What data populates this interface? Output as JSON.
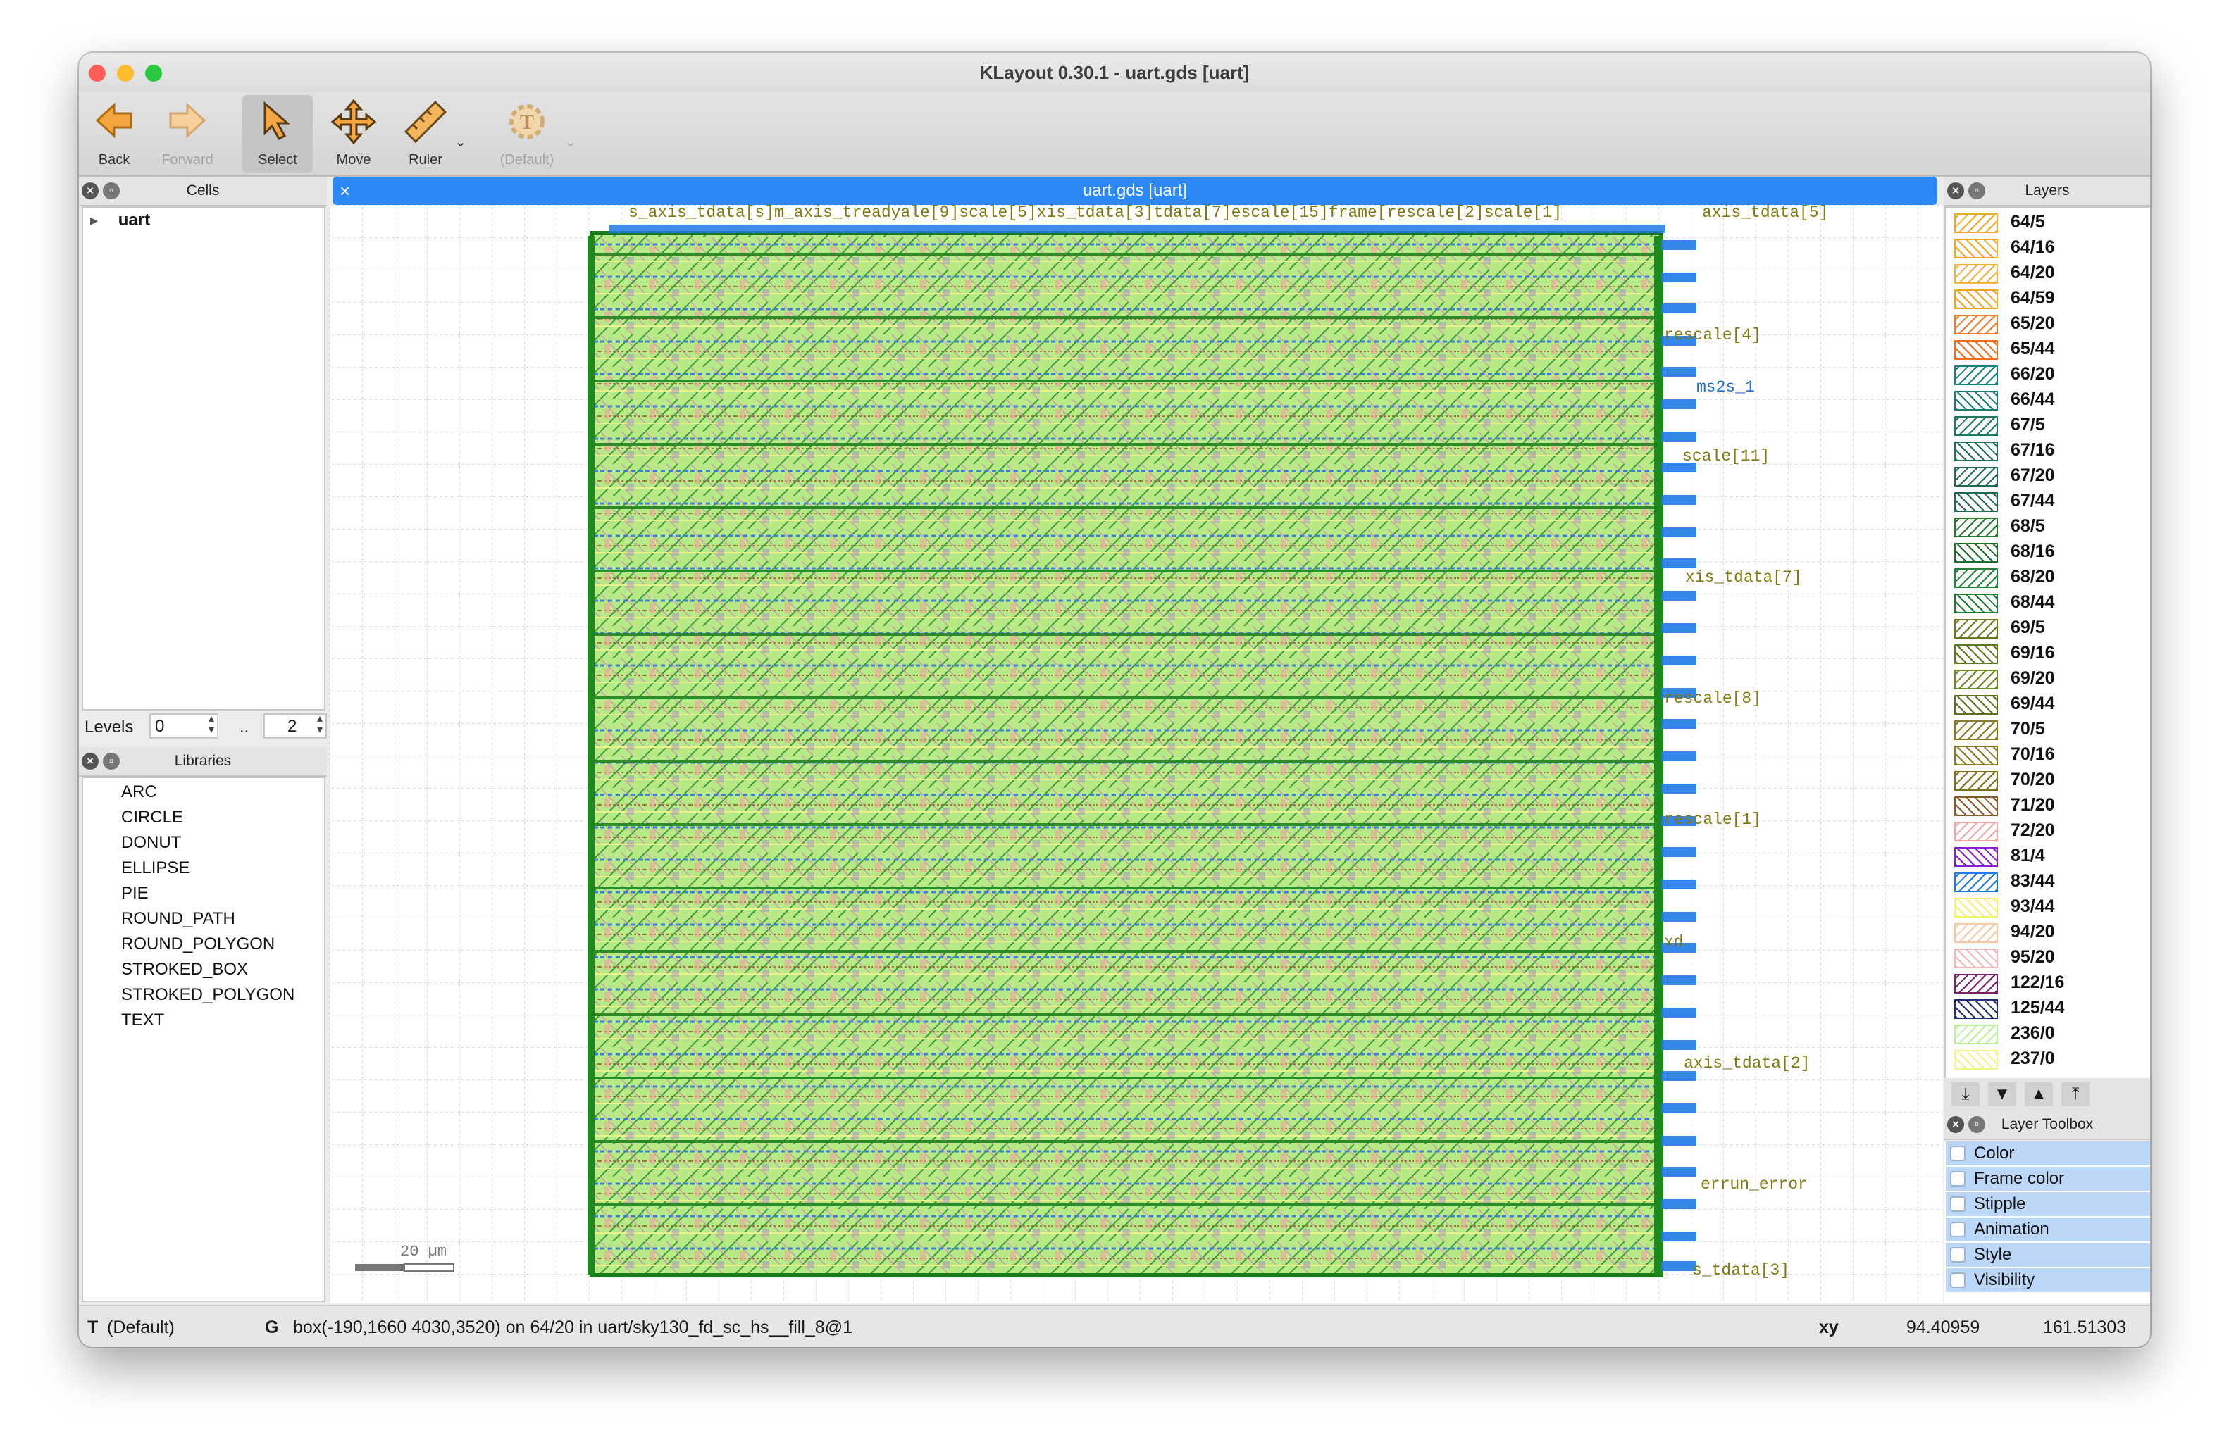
{
  "window": {
    "title": "KLayout 0.30.1 - uart.gds [uart]"
  },
  "toolbar": {
    "buttons": [
      {
        "label": "Back",
        "icon": "back-arrow-icon"
      },
      {
        "label": "Forward",
        "icon": "forward-arrow-icon"
      },
      {
        "label": "Select",
        "icon": "select-cursor-icon"
      },
      {
        "label": "Move",
        "icon": "move-cross-icon"
      },
      {
        "label": "Ruler",
        "icon": "ruler-icon"
      },
      {
        "label": "(Default)",
        "icon": "text-gear-icon"
      }
    ]
  },
  "cells_panel": {
    "title": "Cells",
    "tree": [
      {
        "label": "uart",
        "expander": "▸"
      }
    ],
    "levels": {
      "label": "Levels",
      "from": "0",
      "sep": "..",
      "to": "2"
    }
  },
  "libraries_panel": {
    "title": "Libraries",
    "items": [
      "ARC",
      "CIRCLE",
      "DONUT",
      "ELLIPSE",
      "PIE",
      "ROUND_PATH",
      "ROUND_POLYGON",
      "STROKED_BOX",
      "STROKED_POLYGON",
      "TEXT"
    ]
  },
  "canvas": {
    "tab_title": "uart.gds [uart]",
    "scale_label": "20 µm",
    "top_labels": "s_axis_tdata[s]m_axis_treadyale[9]scale[5]xis_tdata[3]tdata[7]escale[15]frame[rescale[2]scale[1]",
    "top_right_label": "axis_tdata[5]",
    "right_labels": [
      "rescale[4]",
      "ms2s_1",
      "scale[11]",
      "xis_tdata[7]",
      "rescale[8]",
      "rescale[1]",
      "xd",
      "axis_tdata[2]",
      "errun_error",
      "s_tdata[3]"
    ]
  },
  "layers_panel": {
    "title": "Layers",
    "layers": [
      {
        "name": "64/5",
        "color": "#f5a623"
      },
      {
        "name": "64/16",
        "color": "#f5a623"
      },
      {
        "name": "64/20",
        "color": "#f5b13d"
      },
      {
        "name": "64/59",
        "color": "#f2a21e"
      },
      {
        "name": "65/20",
        "color": "#f07b2a"
      },
      {
        "name": "65/44",
        "color": "#f36b1f"
      },
      {
        "name": "66/20",
        "color": "#16837f"
      },
      {
        "name": "66/44",
        "color": "#1a7a78"
      },
      {
        "name": "67/5",
        "color": "#1b7c5c"
      },
      {
        "name": "67/16",
        "color": "#1f6f57"
      },
      {
        "name": "67/20",
        "color": "#236a52"
      },
      {
        "name": "67/44",
        "color": "#1f6a4a"
      },
      {
        "name": "68/5",
        "color": "#237a2f"
      },
      {
        "name": "68/16",
        "color": "#1d6d2a"
      },
      {
        "name": "68/20",
        "color": "#1b8a36"
      },
      {
        "name": "68/44",
        "color": "#1d7a33"
      },
      {
        "name": "69/5",
        "color": "#6a7a1f"
      },
      {
        "name": "69/16",
        "color": "#5d7a1a"
      },
      {
        "name": "69/20",
        "color": "#6b8a25"
      },
      {
        "name": "69/44",
        "color": "#5d7020"
      },
      {
        "name": "70/5",
        "color": "#8b7a1e"
      },
      {
        "name": "70/16",
        "color": "#8a7a22"
      },
      {
        "name": "70/20",
        "color": "#7f6f1a"
      },
      {
        "name": "71/20",
        "color": "#8a5a2a"
      },
      {
        "name": "72/20",
        "color": "#f0a5a5"
      },
      {
        "name": "81/4",
        "color": "#8a1fd0"
      },
      {
        "name": "83/44",
        "color": "#1f7ae6"
      },
      {
        "name": "93/44",
        "color": "#f5f06b"
      },
      {
        "name": "94/20",
        "color": "#f5c9a0"
      },
      {
        "name": "95/20",
        "color": "#f0b7b7"
      },
      {
        "name": "122/16",
        "color": "#7a1f6a"
      },
      {
        "name": "125/44",
        "color": "#1f2f7a"
      },
      {
        "name": "236/0",
        "color": "#b9f29a"
      },
      {
        "name": "237/0",
        "color": "#f3f58a"
      }
    ]
  },
  "layer_toolbox": {
    "title": "Layer Toolbox",
    "items": [
      "Color",
      "Frame color",
      "Stipple",
      "Animation",
      "Style",
      "Visibility"
    ]
  },
  "statusbar": {
    "mode_key": "T",
    "mode_value": "(Default)",
    "grid_key": "G",
    "message": "box(-190,1660 4030,3520) on 64/20 in uart/sky130_fd_sc_hs__fill_8@1",
    "xy_label": "xy",
    "x": "94.40959",
    "y": "161.51303"
  }
}
